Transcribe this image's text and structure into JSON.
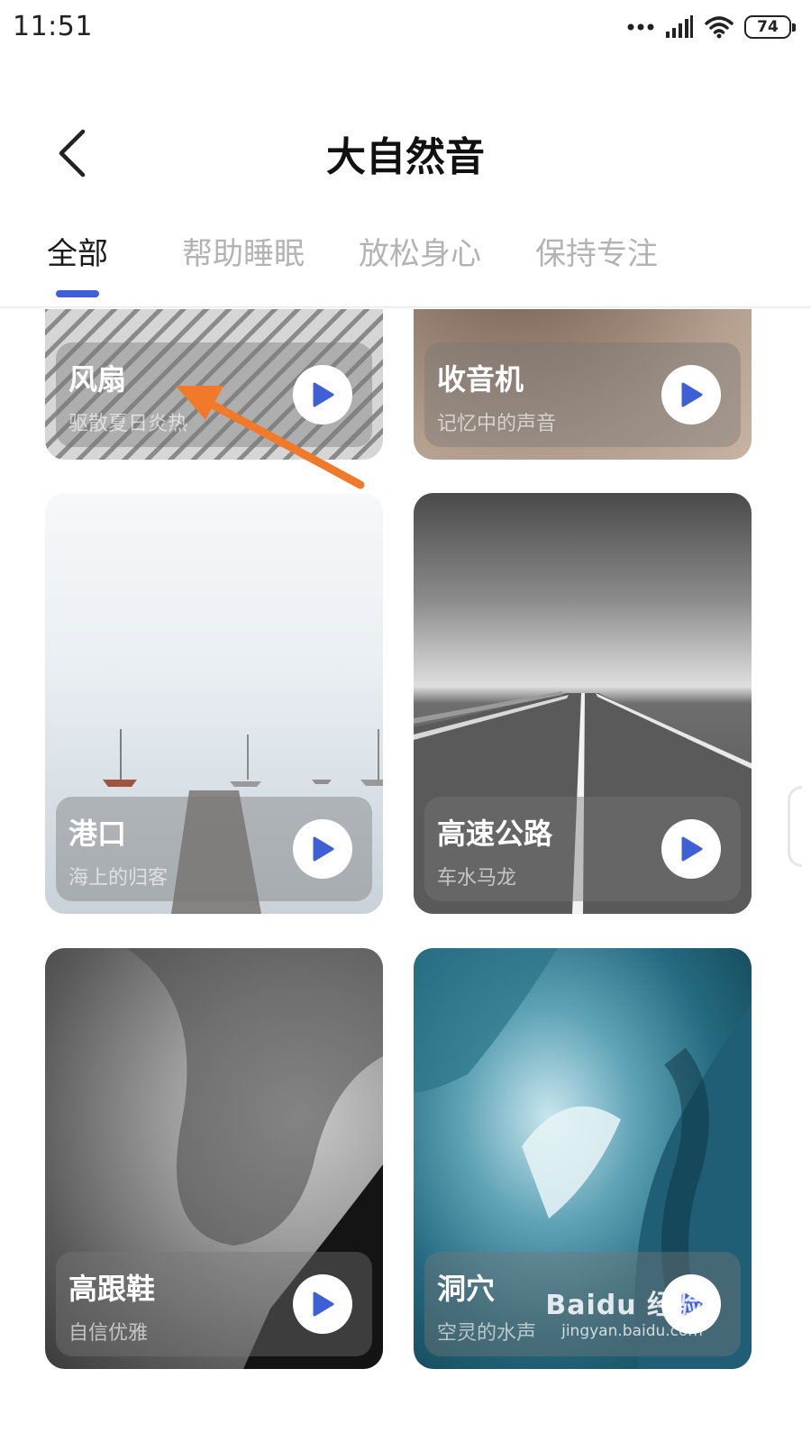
{
  "status_bar": {
    "time": "11:51",
    "battery": "74",
    "icons": [
      "more-dots-icon",
      "cellular-signal-icon",
      "wifi-icon",
      "battery-icon"
    ]
  },
  "header": {
    "title": "大自然音",
    "back_icon": "chevron-left-icon"
  },
  "tabs": [
    {
      "label": "全部",
      "active": true
    },
    {
      "label": "帮助睡眠",
      "active": false
    },
    {
      "label": "放松身心",
      "active": false
    },
    {
      "label": "保持专注",
      "active": false
    }
  ],
  "cards": [
    {
      "title": "风扇",
      "subtitle": "驱散夏日炎热",
      "play_icon": "play-icon"
    },
    {
      "title": "收音机",
      "subtitle": "记忆中的声音",
      "play_icon": "play-icon"
    },
    {
      "title": "港口",
      "subtitle": "海上的归客",
      "play_icon": "play-icon"
    },
    {
      "title": "高速公路",
      "subtitle": "车水马龙",
      "play_icon": "play-icon"
    },
    {
      "title": "高跟鞋",
      "subtitle": "自信优雅",
      "play_icon": "play-icon"
    },
    {
      "title": "洞穴",
      "subtitle": "空灵的水声",
      "play_icon": "play-icon"
    }
  ],
  "annotation": {
    "arrow_color": "#f07a2a",
    "target": "风扇"
  },
  "watermark": {
    "logo": "Baidu 经验",
    "url": "jingyan.baidu.com"
  },
  "colors": {
    "accent": "#3f5fd6",
    "inactive_tab": "#b3b3b3"
  }
}
